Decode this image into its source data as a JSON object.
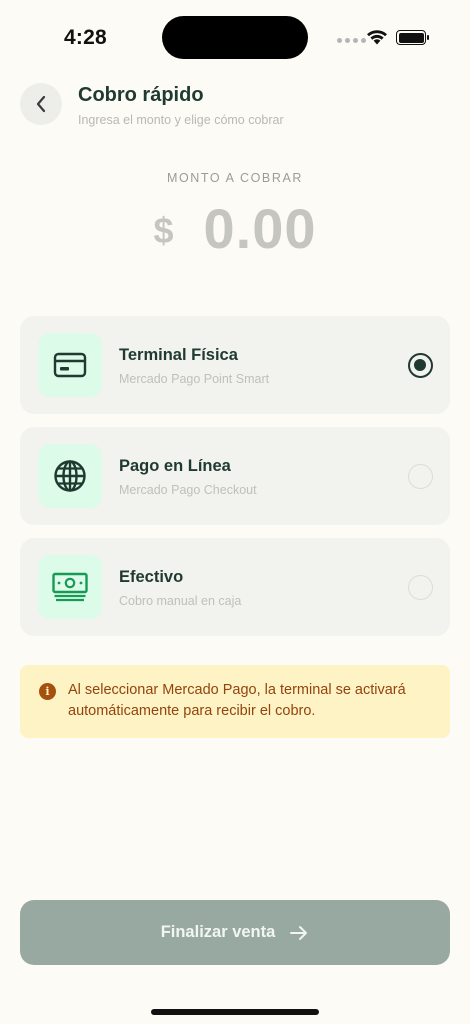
{
  "status_bar": {
    "time": "4:28"
  },
  "header": {
    "title": "Cobro rápido",
    "subtitle": "Ingresa el monto y elige cómo cobrar"
  },
  "amount": {
    "label": "MONTO A COBRAR",
    "currency": "$",
    "value": "0.00"
  },
  "payment_options": [
    {
      "title": "Terminal Física",
      "subtitle": "Mercado Pago Point Smart",
      "icon": "credit-card-icon",
      "selected": true
    },
    {
      "title": "Pago en Línea",
      "subtitle": "Mercado Pago Checkout",
      "icon": "globe-icon",
      "selected": false
    },
    {
      "title": "Efectivo",
      "subtitle": "Cobro manual en caja",
      "icon": "cash-icon",
      "selected": false
    }
  ],
  "notice": {
    "icon": "info-icon",
    "text": "Al seleccionar Mercado Pago, la terminal se activará automáticamente para recibir el cobro."
  },
  "finish_button": {
    "label": "Finalizar venta",
    "icon": "arrow-right-icon"
  },
  "colors": {
    "primary": "#1F3A30",
    "background": "#FDFBF5",
    "option_bg": "#F2F2EE",
    "icon_bg": "#DCFBE8",
    "notice_bg": "#FEF3C4",
    "notice_text": "#93440E",
    "button_disabled": "#97A9A1"
  }
}
